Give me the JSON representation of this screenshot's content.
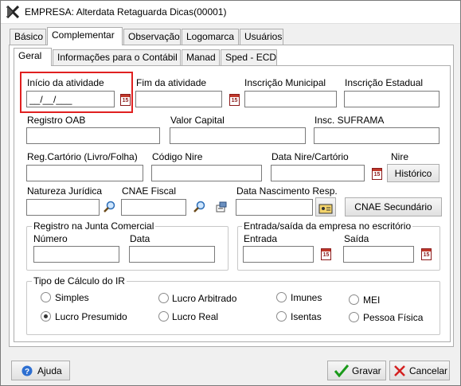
{
  "window": {
    "title": "EMPRESA: Alterdata Retaguarda Dicas(00001)"
  },
  "main_tabs": [
    {
      "label": "Básico"
    },
    {
      "label": "Complementar"
    },
    {
      "label": "Observação"
    },
    {
      "label": "Logomarca"
    },
    {
      "label": "Usuários"
    }
  ],
  "sub_tabs": [
    {
      "label": "Geral"
    },
    {
      "label": "Informações para o Contábil"
    },
    {
      "label": "Manad"
    },
    {
      "label": "Sped - ECD"
    }
  ],
  "fields": {
    "inicio_atividade": {
      "label": "Início da atividade",
      "value": "__/__/___"
    },
    "fim_atividade": {
      "label": "Fim da atividade",
      "value": ""
    },
    "inscricao_municipal": {
      "label": "Inscrição Municipal",
      "value": ""
    },
    "inscricao_estadual": {
      "label": "Inscrição Estadual",
      "value": ""
    },
    "registro_oab": {
      "label": "Registro OAB",
      "value": ""
    },
    "valor_capital": {
      "label": "Valor Capital",
      "value": ""
    },
    "insc_suframa": {
      "label": "Insc. SUFRAMA",
      "value": ""
    },
    "reg_cartorio": {
      "label": "Reg.Cartório (Livro/Folha)",
      "value": ""
    },
    "codigo_nire": {
      "label": "Código Nire",
      "value": ""
    },
    "data_nire": {
      "label": "Data Nire/Cartório",
      "value": ""
    },
    "nire": {
      "label": "Nire"
    },
    "natureza_juridica": {
      "label": "Natureza Jurídica",
      "value": ""
    },
    "cnae_fiscal": {
      "label": "CNAE Fiscal",
      "value": ""
    },
    "data_nasc_resp": {
      "label": "Data Nascimento Resp.",
      "value": ""
    }
  },
  "buttons": {
    "historico": "Histórico",
    "cnae_secundario": "CNAE Secundário",
    "ajuda": "Ajuda",
    "gravar": "Gravar",
    "cancelar": "Cancelar"
  },
  "calendar_icon_text": "15",
  "group_junta": {
    "title": "Registro na Junta Comercial",
    "numero_label": "Número",
    "data_label": "Data"
  },
  "group_entrada_saida": {
    "title": "Entrada/saída da empresa no escritório",
    "entrada_label": "Entrada",
    "saida_label": "Saída"
  },
  "group_ir": {
    "title": "Tipo de Cálculo do IR",
    "options": [
      {
        "label": "Simples",
        "checked": false
      },
      {
        "label": "Lucro Arbitrado",
        "checked": false
      },
      {
        "label": "Imunes",
        "checked": false
      },
      {
        "label": "MEI",
        "checked": false
      },
      {
        "label": "Lucro Presumido",
        "checked": true
      },
      {
        "label": "Lucro Real",
        "checked": false
      },
      {
        "label": "Isentas",
        "checked": false
      },
      {
        "label": "Pessoa Física",
        "checked": false
      }
    ]
  },
  "colors": {
    "highlight": "#e02020",
    "window_bg": "#f0f0f0",
    "panel_bg": "#ffffff"
  }
}
